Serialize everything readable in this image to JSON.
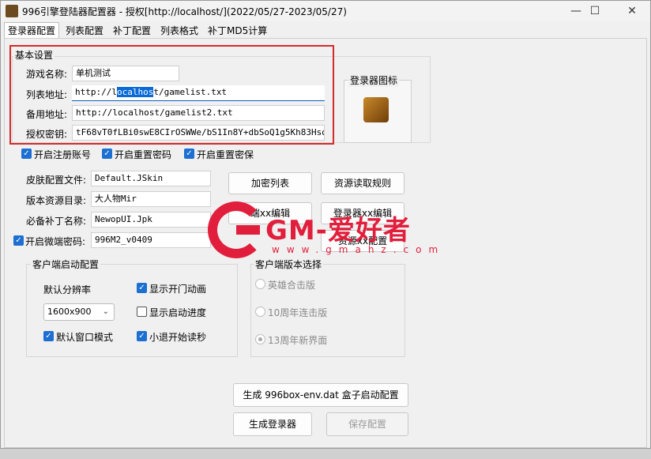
{
  "window": {
    "title": "996引擎登陆器配置器 - 授权[http://localhost/](2022/05/27-2023/05/27)",
    "minimize_glyph": "—",
    "maximize_glyph": "☐",
    "close_glyph": "✕"
  },
  "tabs": [
    {
      "label": "登录器配置",
      "active": true
    },
    {
      "label": "列表配置"
    },
    {
      "label": "补丁配置"
    },
    {
      "label": "列表格式"
    },
    {
      "label": "补丁MD5计算"
    }
  ],
  "basic": {
    "group_title": "基本设置",
    "game_name_label": "游戏名称:",
    "game_name_value": "单机测试",
    "list_url_label": "列表地址:",
    "list_url_prefix": "http://l",
    "list_url_selected": "ocalhos",
    "list_url_suffix": "t/gamelist.txt",
    "backup_url_label": "备用地址:",
    "backup_url_value": "http://localhost/gamelist2.txt",
    "auth_key_label": "授权密钥:",
    "auth_key_value": "tF68vT0fLBi0swE8CIrOSWWe/bS1In8Y+dbSoQ1g5Kh83Hsd/94a",
    "icon_group_title": "登录器图标"
  },
  "options": {
    "enable_register": "开启注册账号",
    "enable_reset_password": "开启重置密码",
    "enable_reset_security": "开启重置密保"
  },
  "resources": {
    "skin_label": "皮肤配置文件:",
    "skin_value": "Default.JSkin",
    "res_dir_label": "版本资源目录:",
    "res_dir_value": "大人物Mir",
    "patch_label": "必备补丁名称:",
    "patch_value": "NewopUI.Jpk",
    "micro_pwd_label": "开启微端密码:",
    "micro_pwd_value": "996M2_v0409"
  },
  "buttons": {
    "encrypt_list": "加密列表",
    "resource_rules": "资源读取规则",
    "client_edit": "端xx编辑",
    "launcher_edit": "登录器xx编辑",
    "resource_config": "资源xx配置",
    "gen_box": "生成 996box-env.dat 盒子启动配置",
    "gen_launcher": "生成登录器",
    "save_config": "保存配置"
  },
  "client_startup": {
    "group_title": "客户端启动配置",
    "resolution_label": "默认分辨率",
    "resolution_value": "1600x900",
    "show_door_anim": "显示开门动画",
    "show_start_progress": "显示启动进度",
    "default_window_mode": "默认窗口模式",
    "quick_read_seconds": "小退开始读秒"
  },
  "client_version": {
    "group_title": "客户端版本选择",
    "opt1": "英雄合击版",
    "opt2": "10周年连击版",
    "opt3": "13周年新界面"
  },
  "watermark": {
    "text": "GM-爱好者",
    "sub": "www.gmahz.com"
  }
}
